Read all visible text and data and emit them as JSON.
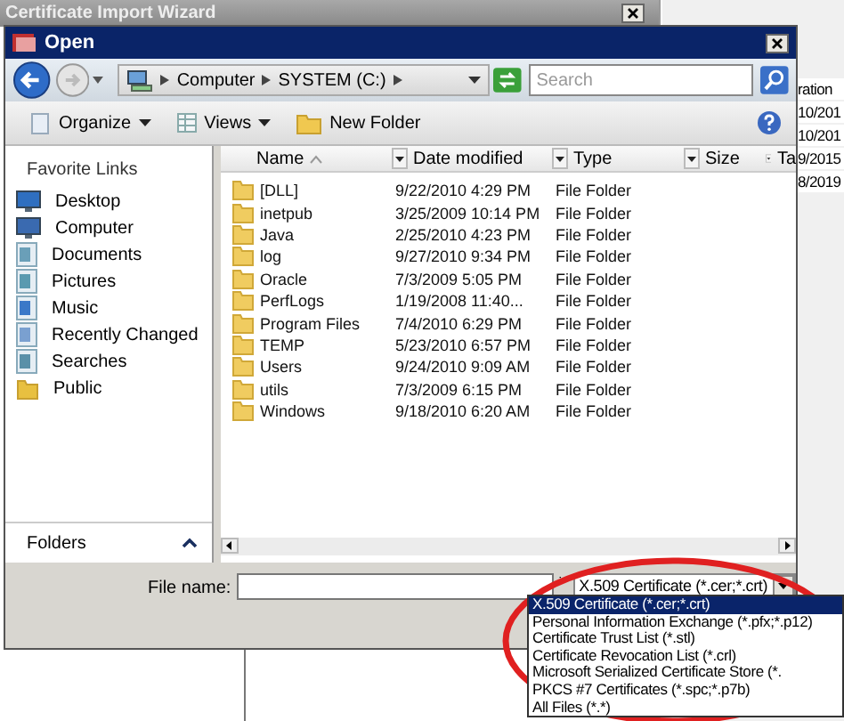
{
  "background_window": {
    "title": "Certificate Import Wizard",
    "peek_texts": [
      "ration",
      "10/201",
      "10/201",
      "9/2015",
      "8/2019"
    ]
  },
  "dialog": {
    "title": "Open",
    "breadcrumb": [
      "Computer",
      "SYSTEM (C:)"
    ],
    "search": {
      "placeholder": "Search"
    },
    "toolbar": [
      {
        "label": "Organize",
        "kind": "organize",
        "dropdown": true
      },
      {
        "label": "Views",
        "kind": "views",
        "dropdown": true
      },
      {
        "label": "New Folder",
        "kind": "new-folder",
        "dropdown": false
      }
    ],
    "favorites_title": "Favorite Links",
    "favorites": [
      {
        "label": "Desktop",
        "kind": "desktop"
      },
      {
        "label": "Computer",
        "kind": "computer"
      },
      {
        "label": "Documents",
        "kind": "documents"
      },
      {
        "label": "Pictures",
        "kind": "pictures"
      },
      {
        "label": "Music",
        "kind": "music"
      },
      {
        "label": "Recently Changed",
        "kind": "recent"
      },
      {
        "label": "Searches",
        "kind": "searches"
      },
      {
        "label": "Public",
        "kind": "folder"
      }
    ],
    "folders_label": "Folders",
    "columns": [
      {
        "label": "Name",
        "sorted": true
      },
      {
        "label": "Date modified",
        "sorted": false
      },
      {
        "label": "Type",
        "sorted": false
      },
      {
        "label": "Size",
        "sorted": false
      },
      {
        "label": "Ta",
        "sorted": false
      }
    ],
    "rows": [
      {
        "name": "[DLL]",
        "date": "9/22/2010 4:29 PM",
        "type": "File Folder"
      },
      {
        "name": "inetpub",
        "date": "3/25/2009 10:14 PM",
        "type": "File Folder"
      },
      {
        "name": "Java",
        "date": "2/25/2010 4:23 PM",
        "type": "File Folder"
      },
      {
        "name": "log",
        "date": "9/27/2010 9:34 PM",
        "type": "File Folder"
      },
      {
        "name": "Oracle",
        "date": "7/3/2009 5:05 PM",
        "type": "File Folder"
      },
      {
        "name": "PerfLogs",
        "date": "1/19/2008 11:40...",
        "type": "File Folder"
      },
      {
        "name": "Program Files",
        "date": "7/4/2010 6:29 PM",
        "type": "File Folder"
      },
      {
        "name": "TEMP",
        "date": "5/23/2010 6:57 PM",
        "type": "File Folder"
      },
      {
        "name": "Users",
        "date": "9/24/2010 9:09 AM",
        "type": "File Folder"
      },
      {
        "name": "utils",
        "date": "7/3/2009 6:15 PM",
        "type": "File Folder"
      },
      {
        "name": "Windows",
        "date": "9/18/2010 6:20 AM",
        "type": "File Folder"
      }
    ],
    "file_name": {
      "label": "File name:"
    },
    "file_type": {
      "value": "X.509 Certificate (*.cer;*.crt)",
      "options": [
        {
          "label": "X.509 Certificate (*.cer;*.crt)",
          "selected": true
        },
        {
          "label": "Personal Information Exchange (*.pfx;*.p12)",
          "selected": false
        },
        {
          "label": "Certificate Trust List (*.stl)",
          "selected": false
        },
        {
          "label": "Certificate Revocation List (*.crl)",
          "selected": false
        },
        {
          "label": "Microsoft Serialized Certificate Store (*.",
          "selected": false
        },
        {
          "label": "PKCS #7 Certificates (*.spc;*.p7b)",
          "selected": false
        },
        {
          "label": "All Files (*.*)",
          "selected": false
        }
      ]
    }
  }
}
